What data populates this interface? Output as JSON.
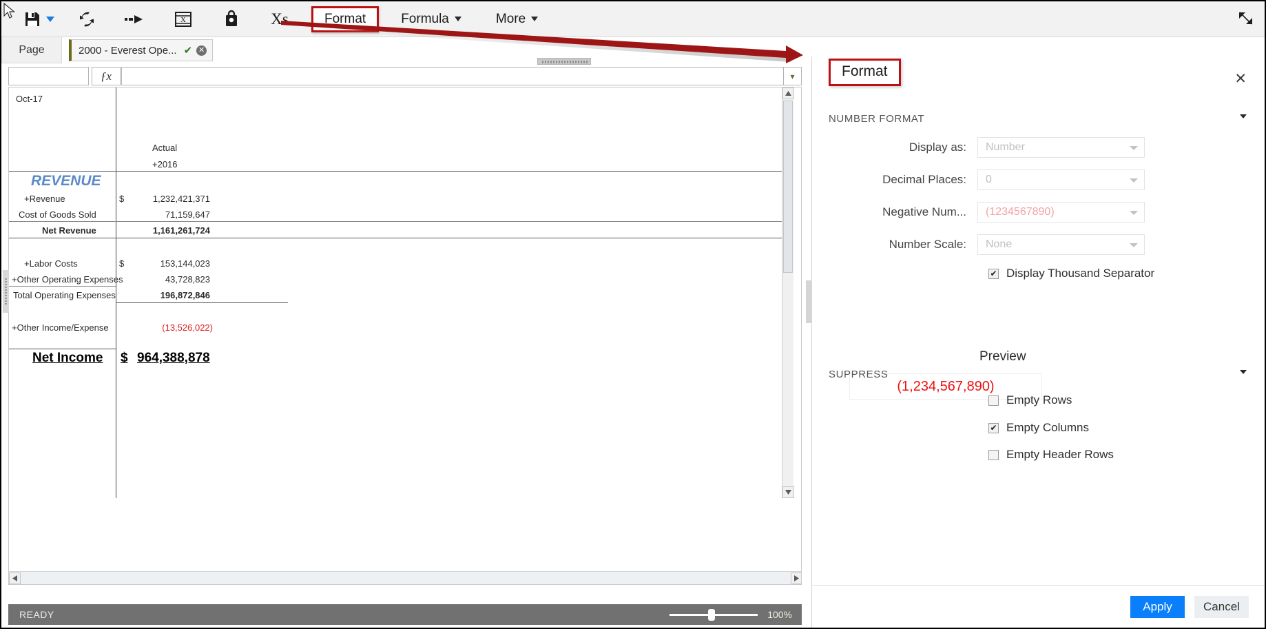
{
  "toolbar": {
    "icons": [
      {
        "name": "save-icon",
        "label": "Save"
      },
      {
        "name": "refresh-icon",
        "label": "Refresh"
      },
      {
        "name": "submit-icon",
        "label": "Submit"
      },
      {
        "name": "excel-export-icon",
        "label": "Export to Excel"
      },
      {
        "name": "lock-icon",
        "label": "Lock"
      },
      {
        "name": "xs-icon",
        "label": "Xs"
      }
    ],
    "xs_label": "Xs",
    "menus": [
      {
        "label": "Format",
        "highlighted": true,
        "has_caret": false
      },
      {
        "label": "Formula",
        "highlighted": false,
        "has_caret": true
      },
      {
        "label": "More",
        "highlighted": false,
        "has_caret": true
      }
    ],
    "restore_icon": "restore-window-icon"
  },
  "pagebar": {
    "page_label": "Page",
    "tab_name": "2000 - Everest Ope...",
    "tab_check": "✔",
    "tab_close": "✕"
  },
  "formula_bar": {
    "name_box_value": "",
    "name_box_placeholder": "",
    "fx_label": "ƒx",
    "formula_value": "",
    "formula_placeholder": ""
  },
  "sheet": {
    "period": "Oct-17",
    "col_header_1": "Actual",
    "col_header_2": "+2016",
    "section_title": "REVENUE",
    "rows": [
      {
        "label": "+Revenue",
        "currency": "$",
        "value": "1,232,421,371",
        "bold": false,
        "negative": false
      },
      {
        "label": "Cost of Goods Sold",
        "currency": "",
        "value": "71,159,647",
        "bold": false,
        "negative": false
      },
      {
        "label": "Net Revenue",
        "currency": "",
        "value": "1,161,261,724",
        "bold": true,
        "negative": false
      },
      {
        "label": "+Labor Costs",
        "currency": "$",
        "value": "153,144,023",
        "bold": false,
        "negative": false
      },
      {
        "label": "+Other Operating Expenses",
        "currency": "",
        "value": "43,728,823",
        "bold": false,
        "negative": false
      },
      {
        "label": "Total Operating Expenses",
        "currency": "",
        "value": "196,872,846",
        "bold": true,
        "negative": false
      },
      {
        "label": "+Other Income/Expense",
        "currency": "",
        "value": "(13,526,022)",
        "bold": false,
        "negative": true
      }
    ],
    "net_income_label": "Net Income",
    "net_income_currency": "$",
    "net_income_value": "964,388,878"
  },
  "statusbar": {
    "status": "READY",
    "zoom": "100%"
  },
  "panel": {
    "title": "Format",
    "close_label": "✕",
    "number_format": {
      "section_label": "NUMBER FORMAT",
      "display_as": {
        "label": "Display as:",
        "value": "Number"
      },
      "decimal_places": {
        "label": "Decimal Places:",
        "value": "0"
      },
      "negative_numbers": {
        "label": "Negative Num...",
        "value": "(1234567890)"
      },
      "number_scale": {
        "label": "Number Scale:",
        "value": "None"
      },
      "thousand_separator": {
        "label": "Display Thousand Separator",
        "checked": true,
        "mark": "✔"
      }
    },
    "preview": {
      "title": "Preview",
      "value": "(1,234,567,890)"
    },
    "suppress": {
      "section_label": "SUPPRESS",
      "items": [
        {
          "label": "Empty Rows",
          "checked": false,
          "mark": ""
        },
        {
          "label": "Empty Columns",
          "checked": true,
          "mark": "✔"
        },
        {
          "label": "Empty Header Rows",
          "checked": false,
          "mark": ""
        }
      ]
    },
    "footer": {
      "apply": "Apply",
      "cancel": "Cancel"
    }
  },
  "colors": {
    "annotation_red": "#bb1111",
    "accent_blue": "#0a7ffb",
    "revenue_blue": "#5b8ac6",
    "negative_red": "#e02020",
    "statusbar_gray": "#717171"
  }
}
